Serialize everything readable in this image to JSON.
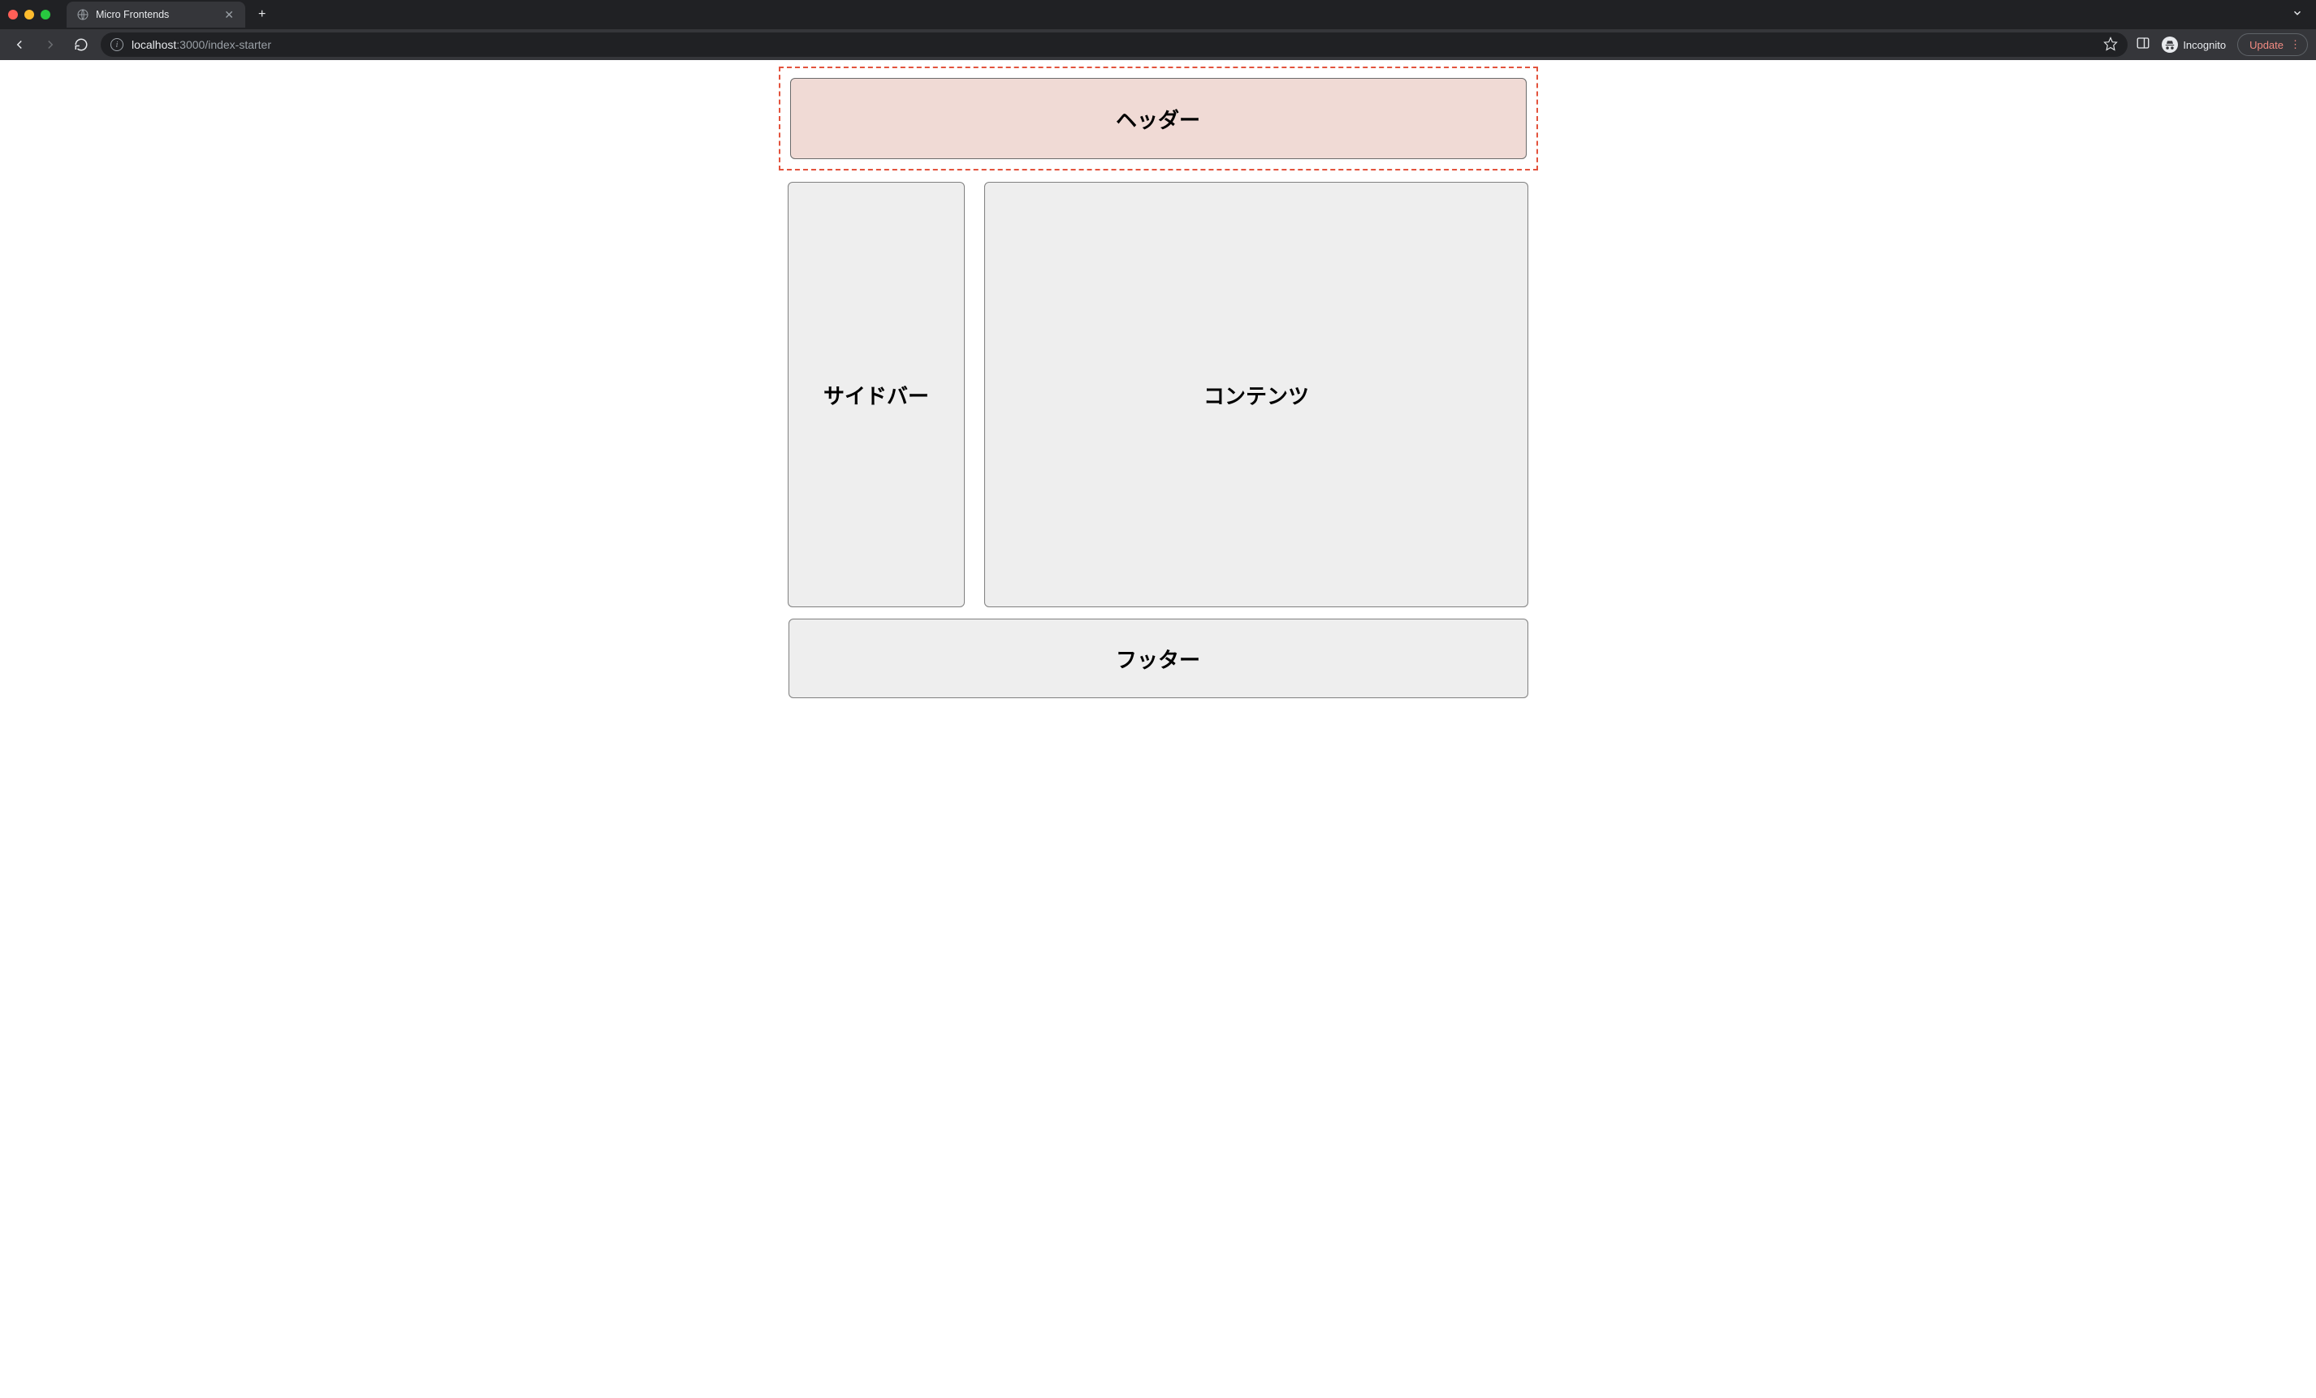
{
  "browser": {
    "tab_title": "Micro Frontends",
    "url_host": "localhost",
    "url_port": ":3000",
    "url_path": "/index-starter",
    "incognito_label": "Incognito",
    "update_label": "Update"
  },
  "page": {
    "header_label": "ヘッダー",
    "sidebar_label": "サイドバー",
    "content_label": "コンテンツ",
    "footer_label": "フッター"
  }
}
